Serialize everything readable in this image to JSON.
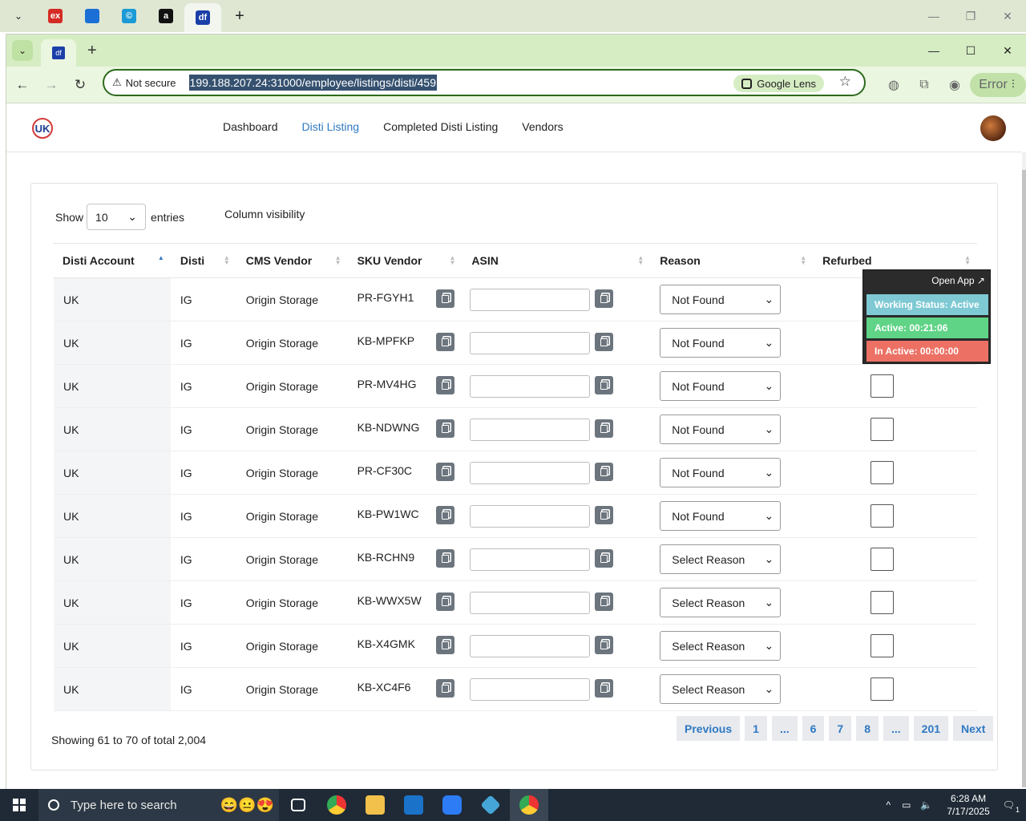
{
  "os_tabs": [
    {
      "name": "ex-tab",
      "label": "ex",
      "color": "#d42c25"
    },
    {
      "name": "blue-app-tab",
      "label": "",
      "color": "#1b6fd6"
    },
    {
      "name": "copyright-tab",
      "label": "©",
      "color": "#1b9ad6"
    },
    {
      "name": "amazon-tab",
      "label": "a",
      "color": "#111111"
    },
    {
      "name": "df-tab",
      "label": "df",
      "color": "#1b3fa8"
    }
  ],
  "browser": {
    "tab_icon": "df",
    "not_secure": "Not secure",
    "url": "199.188.207.24:31000/employee/listings/disti/459",
    "google_lens": "Google Lens",
    "error_label": "Error"
  },
  "nav": {
    "logo": "UK",
    "links": [
      {
        "label": "Dashboard",
        "active": false
      },
      {
        "label": "Disti Listing",
        "active": true
      },
      {
        "label": "Completed Disti Listing",
        "active": false
      },
      {
        "label": "Vendors",
        "active": false
      }
    ]
  },
  "controls": {
    "show": "Show",
    "entries_value": "10",
    "entries": "entries",
    "column_visibility": "Column visibility"
  },
  "table": {
    "headers": [
      "Disti Account",
      "Disti",
      "CMS Vendor",
      "SKU Vendor",
      "ASIN",
      "Reason",
      "Refurbed"
    ],
    "rows": [
      {
        "account": "UK",
        "disti": "IG",
        "cms": "Origin Storage",
        "sku": "PR-FGYH1",
        "reason": "Not Found"
      },
      {
        "account": "UK",
        "disti": "IG",
        "cms": "Origin Storage",
        "sku": "KB-MPFKP",
        "reason": "Not Found"
      },
      {
        "account": "UK",
        "disti": "IG",
        "cms": "Origin Storage",
        "sku": "PR-MV4HG",
        "reason": "Not Found"
      },
      {
        "account": "UK",
        "disti": "IG",
        "cms": "Origin Storage",
        "sku": "KB-NDWNG",
        "reason": "Not Found"
      },
      {
        "account": "UK",
        "disti": "IG",
        "cms": "Origin Storage",
        "sku": "PR-CF30C",
        "reason": "Not Found"
      },
      {
        "account": "UK",
        "disti": "IG",
        "cms": "Origin Storage",
        "sku": "KB-PW1WC",
        "reason": "Not Found"
      },
      {
        "account": "UK",
        "disti": "IG",
        "cms": "Origin Storage",
        "sku": "KB-RCHN9",
        "reason": "Select Reason"
      },
      {
        "account": "UK",
        "disti": "IG",
        "cms": "Origin Storage",
        "sku": "KB-WWX5W",
        "reason": "Select Reason"
      },
      {
        "account": "UK",
        "disti": "IG",
        "cms": "Origin Storage",
        "sku": "KB-X4GMK",
        "reason": "Select Reason"
      },
      {
        "account": "UK",
        "disti": "IG",
        "cms": "Origin Storage",
        "sku": "KB-XC4F6",
        "reason": "Select Reason"
      }
    ]
  },
  "footer": {
    "showing": "Showing 61 to 70 of total 2,004",
    "pages": [
      "Previous",
      "1",
      "...",
      "6",
      "7",
      "8",
      "...",
      "201",
      "Next"
    ]
  },
  "timer": {
    "open_app": "Open App ↗",
    "status": "Working Status: Active",
    "active": "Active: 00:21:06",
    "inactive": "In Active: 00:00:00",
    "colors": {
      "status": "#7ec9d3",
      "active": "#5fd486",
      "inactive": "#ec7164"
    }
  },
  "taskbar": {
    "search_placeholder": "Type here to search",
    "time": "6:28 AM",
    "date": "7/17/2025",
    "notifications": "1"
  }
}
